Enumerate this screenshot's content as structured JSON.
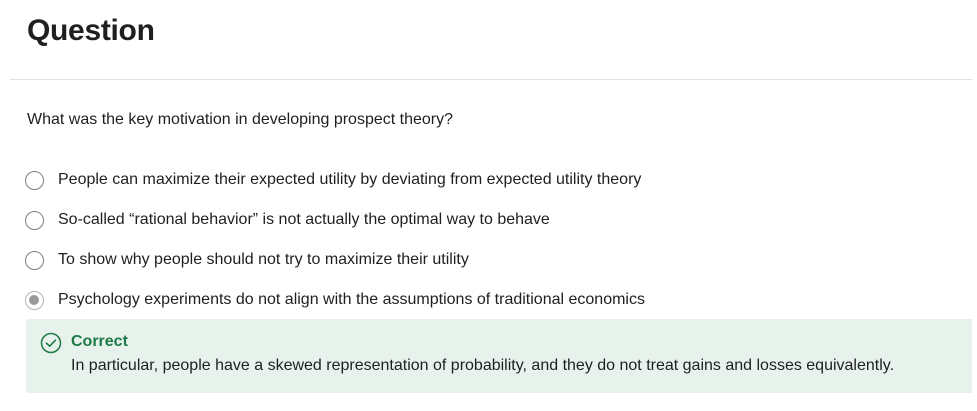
{
  "header": {
    "title": "Question"
  },
  "question": {
    "prompt": "What was the key motivation in developing prospect theory?",
    "options": [
      {
        "label": "People can maximize their expected utility by deviating from expected utility theory",
        "selected": false
      },
      {
        "label": "So-called “rational behavior” is not actually the optimal way to behave",
        "selected": false
      },
      {
        "label": "To show why people should not try to maximize their utility",
        "selected": false
      },
      {
        "label": "Psychology experiments do not align with the assumptions of traditional economics",
        "selected": true
      }
    ]
  },
  "feedback": {
    "status": "Correct",
    "icon": "check-circle-icon",
    "explanation": "In particular, people have a skewed representation of probability, and they do not treat gains and losses equivalently.",
    "accent_color": "#1d7a46",
    "background_color": "#e8f2ec"
  }
}
